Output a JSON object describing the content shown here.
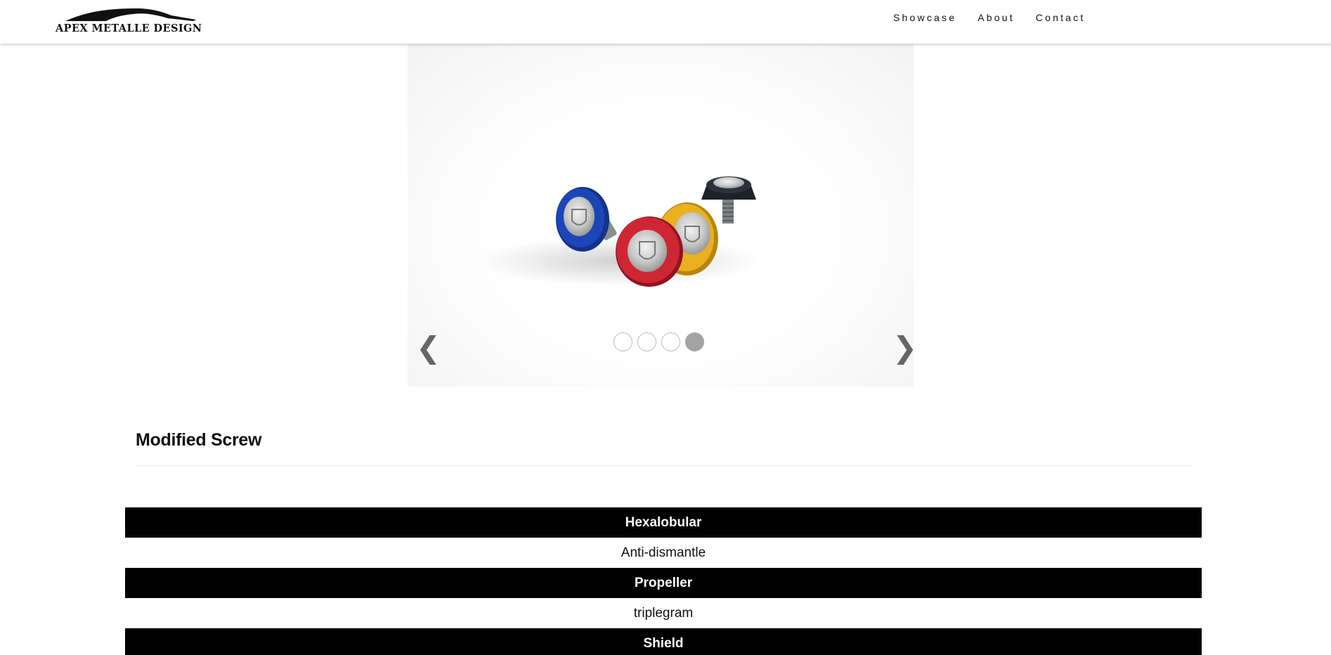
{
  "brand": {
    "name": "APEX METALLE DESIGN"
  },
  "nav": {
    "items": [
      {
        "label": "Showcase"
      },
      {
        "label": "About"
      },
      {
        "label": "Contact"
      }
    ]
  },
  "carousel": {
    "prev_icon": "chevron-left-icon",
    "next_icon": "chevron-right-icon",
    "prev_glyph": "❮",
    "next_glyph": "❯",
    "slide_count": 4,
    "active_index": 3,
    "slide_subject": "colored screws: blue, red, gold, black"
  },
  "section": {
    "title": "Modified Screw"
  },
  "types": {
    "items": [
      {
        "label": "Hexalobular",
        "style": "dark"
      },
      {
        "label": "Anti-dismantle",
        "style": "light"
      },
      {
        "label": "Propeller",
        "style": "dark"
      },
      {
        "label": "triplegram",
        "style": "light"
      },
      {
        "label": "Shield",
        "style": "dark"
      }
    ]
  },
  "colors": {
    "header_bg": "#ffffff",
    "dark_row_bg": "#000000",
    "dot_active": "#a3a3a3",
    "screw_blue": "#1c3fa8",
    "screw_red": "#c0202c",
    "screw_gold": "#e0a81a",
    "screw_black": "#222a30"
  }
}
